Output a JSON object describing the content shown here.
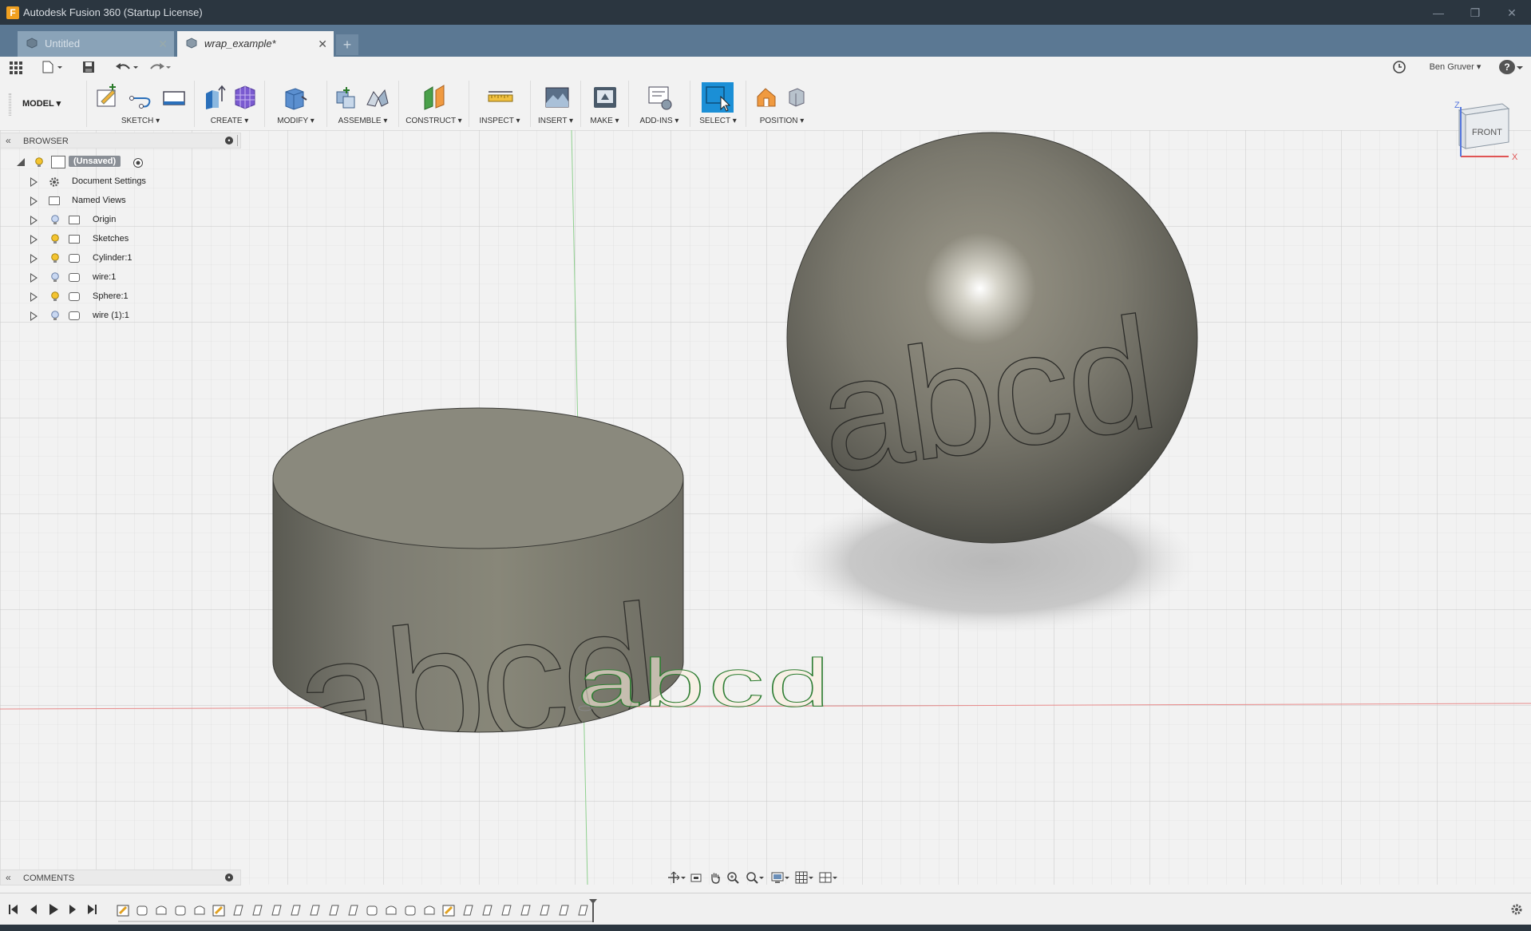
{
  "window": {
    "title": "Autodesk Fusion 360 (Startup License)"
  },
  "tabs": [
    {
      "label": "Untitled",
      "active": false
    },
    {
      "label": "wrap_example*",
      "active": true
    }
  ],
  "quick_access": {
    "user": "Ben Gruver ▾",
    "help": "?"
  },
  "toolbar": {
    "workspace": "MODEL ▾",
    "groups": [
      {
        "label": "SKETCH ▾"
      },
      {
        "label": "CREATE ▾"
      },
      {
        "label": "MODIFY ▾"
      },
      {
        "label": "ASSEMBLE ▾"
      },
      {
        "label": "CONSTRUCT ▾"
      },
      {
        "label": "INSPECT ▾"
      },
      {
        "label": "INSERT ▾"
      },
      {
        "label": "MAKE ▾"
      },
      {
        "label": "ADD-INS ▾"
      },
      {
        "label": "SELECT ▾"
      },
      {
        "label": "POSITION ▾"
      }
    ]
  },
  "browser": {
    "title": "BROWSER",
    "root": "(Unsaved)",
    "items": [
      {
        "label": "Document Settings",
        "icon": "gear-icon"
      },
      {
        "label": "Named Views",
        "icon": "folder-icon"
      },
      {
        "label": "Origin",
        "icon": "folder-icon"
      },
      {
        "label": "Sketches",
        "icon": "folder-icon"
      },
      {
        "label": "Cylinder:1",
        "icon": "body-icon"
      },
      {
        "label": "wire:1",
        "icon": "body-icon"
      },
      {
        "label": "Sphere:1",
        "icon": "body-icon"
      },
      {
        "label": "wire (1):1",
        "icon": "body-icon"
      }
    ]
  },
  "viewport": {
    "cylinder_text": "abcd",
    "sphere_text": "abcd",
    "sketch_text": "abcd",
    "viewcube": {
      "face": "FRONT",
      "axis_z": "Z",
      "axis_x": "X"
    }
  },
  "comments": {
    "title": "COMMENTS"
  },
  "colors": {
    "titlebar": "#2b3640",
    "tabbar": "#5b7893",
    "select_accent": "#1b8fd6",
    "sketch_green": "#2e7d32",
    "axis_red": "#e06060",
    "axis_green": "#6fc06f"
  }
}
